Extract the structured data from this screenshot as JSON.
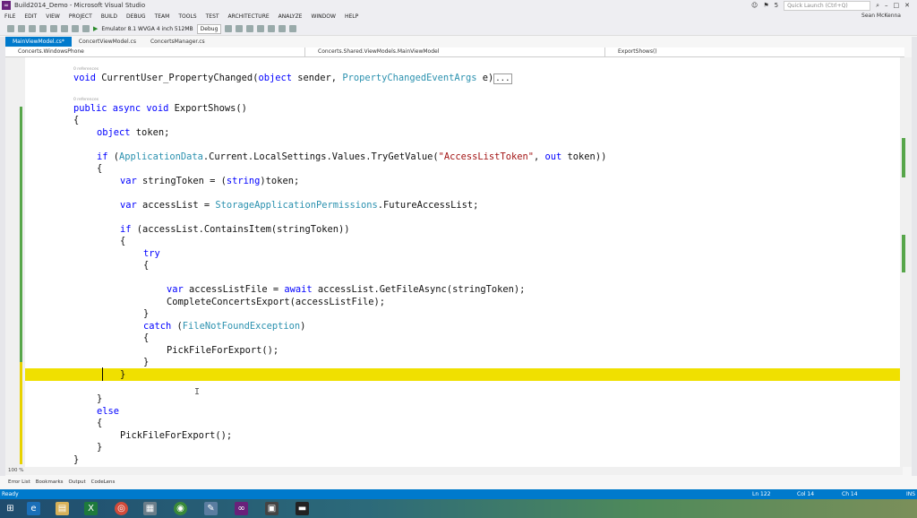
{
  "window": {
    "title": "Build2014_Demo - Microsoft Visual Studio",
    "quick_launch_placeholder": "Quick Launch (Ctrl+Q)",
    "flag_count": "5"
  },
  "menu": [
    "FILE",
    "EDIT",
    "VIEW",
    "PROJECT",
    "BUILD",
    "DEBUG",
    "TEAM",
    "TOOLS",
    "TEST",
    "ARCHITECTURE",
    "ANALYZE",
    "WINDOW",
    "HELP"
  ],
  "user": "Sean McKenna",
  "toolbar": {
    "run_target": "Emulator 8.1 WVGA 4 inch 512MB",
    "config": "Debug"
  },
  "tabs": [
    "MainViewModel.cs*",
    "ConcertViewModel.cs",
    "ConcertsManager.cs"
  ],
  "nav": {
    "project": "Concerts.WindowsPhone",
    "type": "Concerts.Shared.ViewModels.MainViewModel",
    "member": "ExportShows()"
  },
  "codelens_label": "0 references",
  "code": {
    "l1": {
      "kw": "void",
      "name": " CurrentUser_PropertyChanged(",
      "kw2": "object",
      "mid": " sender, ",
      "type": "PropertyChangedEventArgs",
      "end": " e)",
      "collapsed": "..."
    },
    "l2": {
      "kw": "public async void",
      "rest": " ExportShows()"
    },
    "l3": "{",
    "l4": {
      "kw": "object",
      "rest": " token;"
    },
    "l5": {
      "kw": "if",
      "p1": " (",
      "type": "ApplicationData",
      "rest": ".Current.LocalSettings.Values.TryGetValue(",
      "str": "\"AccessListToken\"",
      "comma": ", ",
      "kw2": "out",
      "end": " token))"
    },
    "l6": "{",
    "l7": {
      "kw": "var",
      "mid": " stringToken = (",
      "kw2": "string",
      "end": ")token;"
    },
    "l8": {
      "kw": "var",
      "mid": " accessList = ",
      "type": "StorageApplicationPermissions",
      "end": ".FutureAccessList;"
    },
    "l9": {
      "kw": "if",
      "rest": " (accessList.ContainsItem(stringToken))"
    },
    "l10": "{",
    "l11": "try",
    "l12": "{",
    "l13": {
      "kw": "var",
      "mid": " accessListFile = ",
      "kw2": "await",
      "end": " accessList.GetFileAsync(stringToken);"
    },
    "l14": "CompleteConcertsExport(accessListFile);",
    "l15": "}",
    "l16": {
      "kw": "catch",
      "p1": " (",
      "type": "FileNotFoundException",
      "end": ")"
    },
    "l17": "{",
    "l18": "PickFileForExport();",
    "l19": "}",
    "l20": "}",
    "l21": "}",
    "l22": "else",
    "l23": "{",
    "l24": "PickFileForExport();",
    "l25": "}",
    "l26": "}"
  },
  "zoom": "100 %",
  "bottom_tabs": [
    "Error List",
    "Bookmarks",
    "Output",
    "CodeLens"
  ],
  "status": {
    "left": "Ready",
    "ln": "Ln 122",
    "col": "Col 14",
    "ch": "Ch 14",
    "mode": "INS"
  },
  "colors": {
    "accent": "#007acc",
    "highlight": "#f0e000",
    "keyword": "#0000ff",
    "type": "#2b91af",
    "string": "#a31515"
  }
}
